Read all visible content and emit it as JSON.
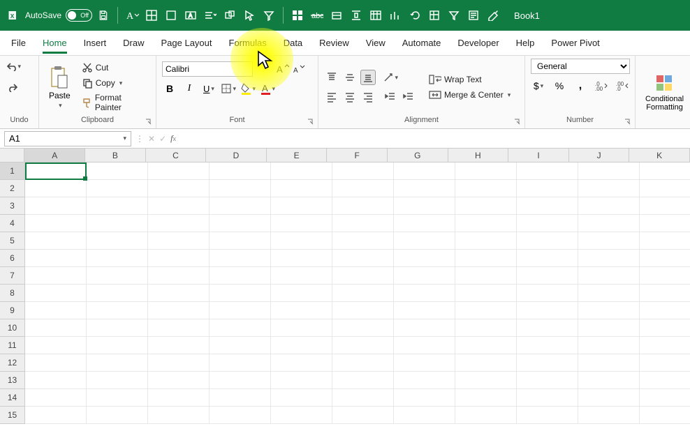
{
  "titlebar": {
    "autosave_label": "AutoSave",
    "autosave_state": "Off",
    "book_title": "Book1"
  },
  "tabs": [
    "File",
    "Home",
    "Insert",
    "Draw",
    "Page Layout",
    "Formulas",
    "Data",
    "Review",
    "View",
    "Automate",
    "Developer",
    "Help",
    "Power Pivot"
  ],
  "active_tab": "Home",
  "ribbon": {
    "undo": {
      "label": "Undo"
    },
    "clipboard": {
      "label": "Clipboard",
      "paste": "Paste",
      "cut": "Cut",
      "copy": "Copy",
      "format_painter": "Format Painter"
    },
    "font": {
      "label": "Font",
      "font_name": "Calibri"
    },
    "alignment": {
      "label": "Alignment",
      "wrap_text": "Wrap Text",
      "merge_center": "Merge & Center"
    },
    "number": {
      "label": "Number",
      "format": "General"
    },
    "styles": {
      "conditional": "Conditional Formatting"
    }
  },
  "formula_bar": {
    "name_box": "A1",
    "formula": ""
  },
  "grid": {
    "columns": [
      "A",
      "B",
      "C",
      "D",
      "E",
      "F",
      "G",
      "H",
      "I",
      "J",
      "K"
    ],
    "rows": [
      "1",
      "2",
      "3",
      "4",
      "5",
      "6",
      "7",
      "8",
      "9",
      "10",
      "11",
      "12",
      "13",
      "14",
      "15"
    ],
    "active_cell": "A1"
  }
}
